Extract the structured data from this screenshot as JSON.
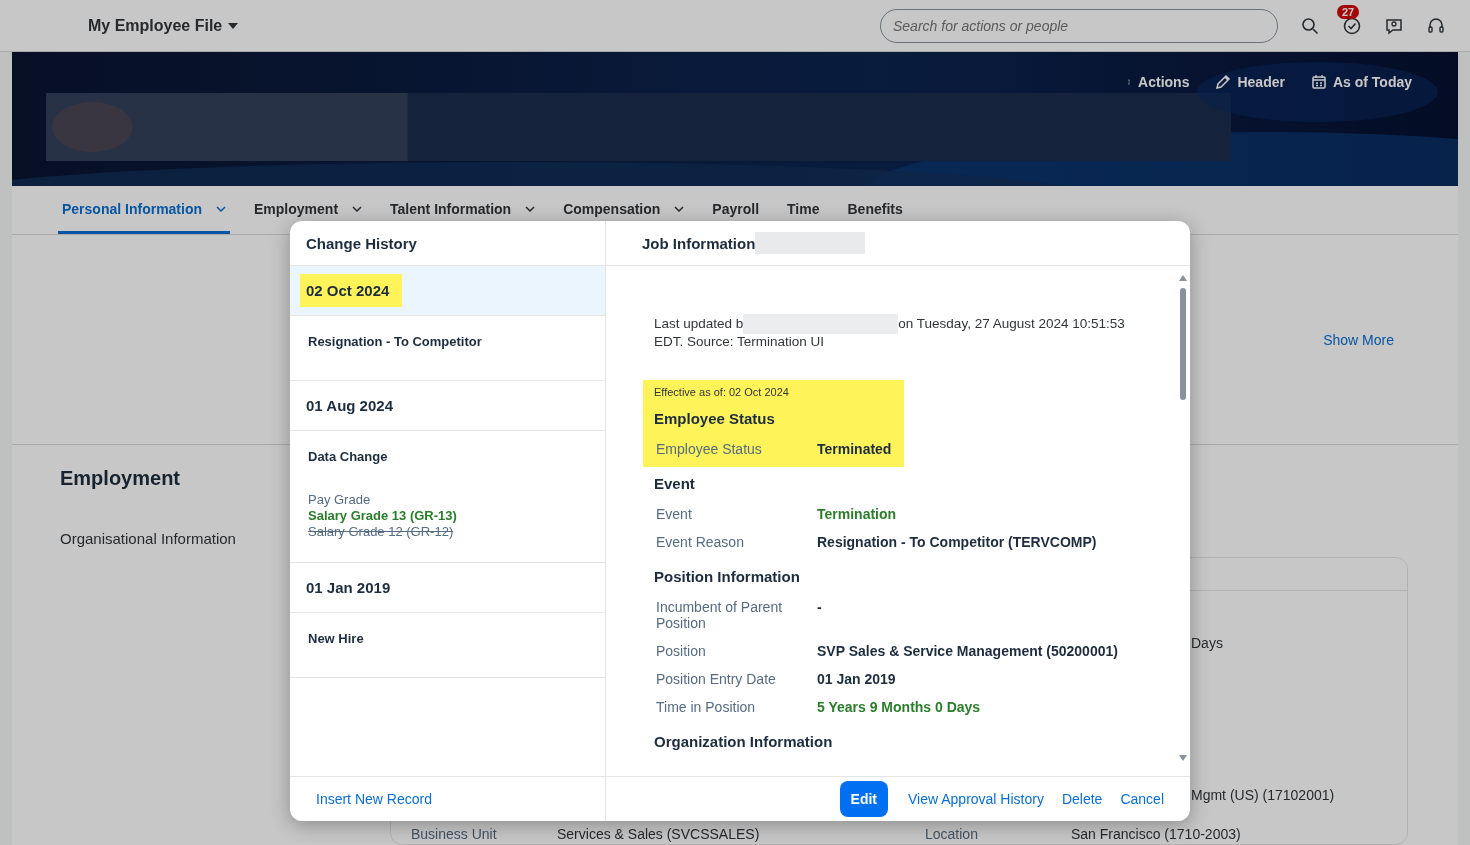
{
  "topbar": {
    "title": "My Employee File",
    "search": {
      "placeholder": "Search for actions or people"
    },
    "notification_count": "27"
  },
  "header_actions": [
    {
      "label": "Actions",
      "kind": "more"
    },
    {
      "label": "Header",
      "kind": "pencil"
    },
    {
      "label": "As of Today",
      "kind": "calendar"
    }
  ],
  "tabs": [
    {
      "label": "Personal Information",
      "selected": true,
      "has_menu": true
    },
    {
      "label": "Employment",
      "selected": false,
      "has_menu": true
    },
    {
      "label": "Talent Information",
      "selected": false,
      "has_menu": true
    },
    {
      "label": "Compensation",
      "selected": false,
      "has_menu": true
    },
    {
      "label": "Payroll",
      "selected": false,
      "has_menu": false
    },
    {
      "label": "Time",
      "selected": false,
      "has_menu": false
    },
    {
      "label": "Benefits",
      "selected": false,
      "has_menu": false
    }
  ],
  "show_more": "Show More",
  "section": {
    "title": "Employment",
    "subsection": "Organisational Information"
  },
  "background_card": {
    "days": "Days",
    "org_value": "Mgmt (US) (17102001)",
    "fields": [
      {
        "label": "Business Unit",
        "value": "Services & Sales (SVCSSALES)"
      },
      {
        "label": "Location",
        "value": "San Francisco (1710-2003)"
      }
    ]
  },
  "dialog": {
    "history_title": "Change History",
    "history": [
      {
        "date": "02 Oct 2024",
        "selected": true,
        "highlighted": true,
        "event": "Resignation - To Competitor"
      },
      {
        "date": "01 Aug 2024",
        "selected": false,
        "highlighted": false,
        "event": "Data Change",
        "changes": [
          {
            "label": "Pay Grade",
            "new": "Salary Grade 13 (GR-13)",
            "old": "Salary Grade 12 (GR-12)"
          }
        ]
      },
      {
        "date": "01 Jan 2019",
        "selected": false,
        "highlighted": false,
        "event": "New Hire"
      }
    ],
    "insert_link": "Insert New Record",
    "detail_title": "Job Information",
    "last_updated_before": "Last updated b",
    "last_updated_after": "on Tuesday, 27 August 2024 10:51:53 EDT. Source: Termination UI",
    "sections": [
      {
        "effective": "Effective as of: 02 Oct 2024",
        "highlighted": true,
        "title": "Employee Status",
        "fields": [
          {
            "label": "Employee Status",
            "value": "Terminated",
            "changed": false
          }
        ]
      },
      {
        "highlighted": false,
        "title": "Event",
        "fields": [
          {
            "label": "Event",
            "value": "Termination",
            "changed": true
          },
          {
            "label": "Event Reason",
            "value": "Resignation - To Competitor (TERVCOMP)",
            "changed": false
          }
        ]
      },
      {
        "highlighted": false,
        "title": "Position Information",
        "fields": [
          {
            "label": "Incumbent of Parent Position",
            "value": "-",
            "changed": false
          },
          {
            "label": "Position",
            "value": "SVP Sales & Service Management (50200001)",
            "changed": false
          },
          {
            "label": "Position Entry Date",
            "value": "01 Jan 2019",
            "changed": false
          },
          {
            "label": "Time in Position",
            "value": "5 Years 9 Months 0 Days",
            "changed": true
          }
        ]
      },
      {
        "highlighted": false,
        "title": "Organization Information"
      }
    ],
    "buttons": [
      {
        "label": "Edit",
        "kind": "primary"
      },
      {
        "label": "View Approval History",
        "kind": "link"
      },
      {
        "label": "Delete",
        "kind": "link"
      },
      {
        "label": "Cancel",
        "kind": "link"
      }
    ]
  }
}
